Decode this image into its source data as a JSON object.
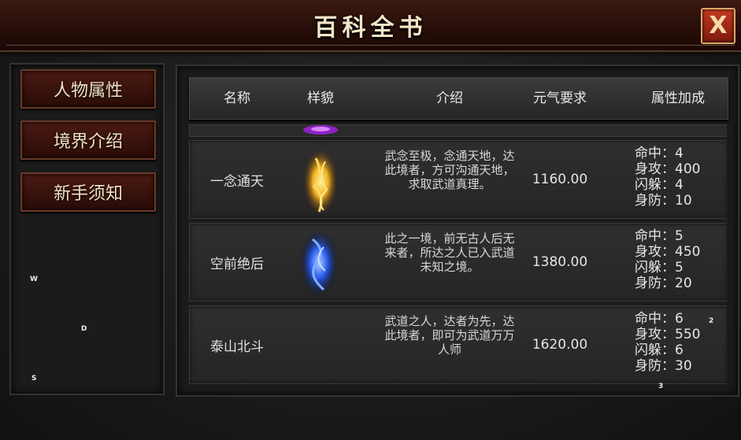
{
  "window": {
    "title": "百科全书",
    "close_label": "X"
  },
  "sidebar": {
    "items": [
      {
        "label": "人物属性"
      },
      {
        "label": "境界介绍"
      },
      {
        "label": "新手须知"
      }
    ]
  },
  "key_hints": {
    "w": "W",
    "d": "D",
    "s": "S",
    "two": "2",
    "three": "3"
  },
  "table": {
    "headers": [
      "名称",
      "样貌",
      "介绍",
      "元气要求",
      "属性加成"
    ],
    "rows": [
      {
        "name": "一念通天",
        "aura_color": "#f0b020",
        "description": "武念至极，念通天地，达此境者，方可沟通天地，求取武道真理。",
        "requirement": "1160.00",
        "attributes": [
          "命中：4",
          "身攻：400",
          "闪躲：4",
          "身防：10"
        ]
      },
      {
        "name": "空前绝后",
        "aura_color": "#2a5cf0",
        "description": "此之一境，前无古人后无来者，所达之人已入武道未知之境。",
        "requirement": "1380.00",
        "attributes": [
          "命中：5",
          "身攻：450",
          "闪躲：5",
          "身防：20"
        ]
      },
      {
        "name": "泰山北斗",
        "aura_color": "",
        "description": "武道之人，达者为先，达此境者，即可为武道万万人师",
        "requirement": "1620.00",
        "attributes": [
          "命中：6",
          "身攻：550",
          "闪躲：6",
          "身防：30"
        ]
      }
    ]
  }
}
